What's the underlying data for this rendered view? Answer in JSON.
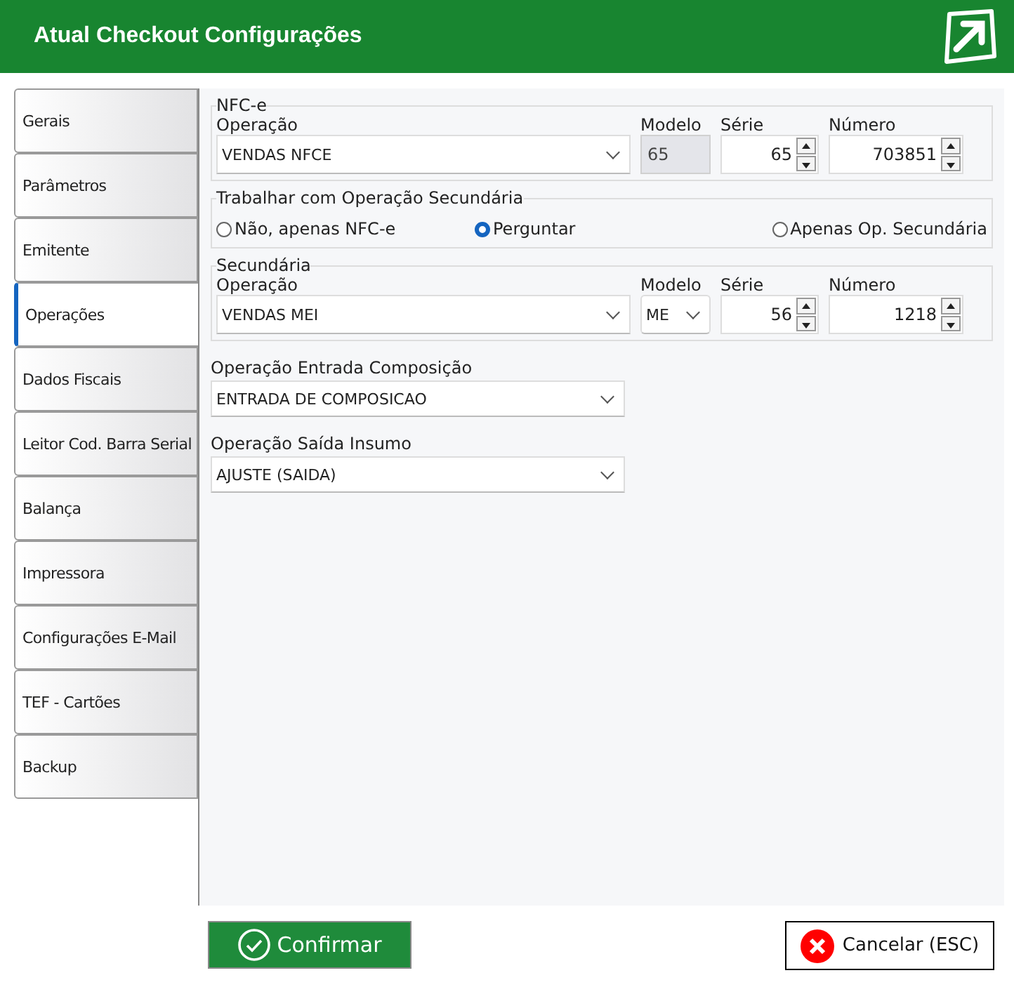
{
  "window": {
    "title": "Atual Checkout Configurações"
  },
  "tabs": [
    {
      "label": "Gerais",
      "selected": false
    },
    {
      "label": "Parâmetros",
      "selected": false
    },
    {
      "label": "Emitente",
      "selected": false
    },
    {
      "label": "Operações",
      "selected": true
    },
    {
      "label": "Dados Fiscais",
      "selected": false
    },
    {
      "label": "Leitor Cod. Barra Serial",
      "selected": false
    },
    {
      "label": "Balança",
      "selected": false
    },
    {
      "label": "Impressora",
      "selected": false
    },
    {
      "label": "Configurações E-Mail",
      "selected": false
    },
    {
      "label": "TEF - Cartões",
      "selected": false
    },
    {
      "label": "Backup",
      "selected": false
    }
  ],
  "nfce": {
    "legend": "NFC-e",
    "operacao": {
      "label": "Operação",
      "value": "VENDAS NFCE"
    },
    "modelo": {
      "label": "Modelo",
      "value": "65",
      "kind": "readonly"
    },
    "serie": {
      "label": "Série",
      "value": "65"
    },
    "numero": {
      "label": "Número",
      "value": "703851"
    }
  },
  "secondary_mode": {
    "legend": "Trabalhar com Operação Secundária",
    "options": [
      {
        "label": "Não, apenas NFC-e",
        "selected": false
      },
      {
        "label": "Perguntar",
        "selected": true
      },
      {
        "label": "Apenas Op. Secundária",
        "selected": false
      }
    ]
  },
  "secundaria": {
    "legend": "Secundária",
    "operacao": {
      "label": "Operação",
      "value": "VENDAS MEI"
    },
    "modelo": {
      "label": "Modelo",
      "value": "ME",
      "kind": "select"
    },
    "serie": {
      "label": "Série",
      "value": "56"
    },
    "numero": {
      "label": "Número",
      "value": "1218"
    }
  },
  "selects": [
    {
      "label": "Operação Entrada Composição",
      "value": "ENTRADA DE COMPOSICAO"
    },
    {
      "label": "Operação Saída Insumo",
      "value": "AJUSTE (SAIDA)"
    }
  ],
  "buttons": {
    "confirm": "Confirmar",
    "cancel": "Cancelar (ESC)"
  }
}
